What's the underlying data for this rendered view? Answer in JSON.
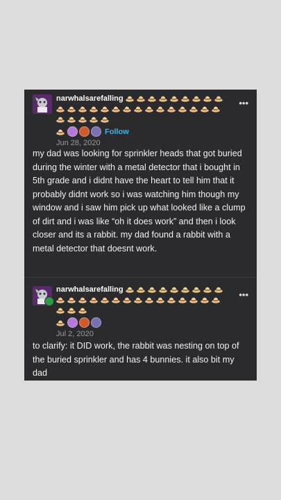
{
  "posts": [
    {
      "username": "narwhalsarefalling",
      "hat_icon": "straw-hat-emoji",
      "hat_count": 29,
      "pics": [
        "#b47ad9",
        "#d05a2a",
        "#7a6fb0"
      ],
      "follow_label": "Follow",
      "date": "Jun 28, 2020",
      "text": "my dad was looking for sprinkler heads that got buried during the winter with a metal detector that i bought in 5th grade and i didnt have the heart to tell him that it probably didnt work so i was watching him though my window and i saw him pick up what looked like a clump of dirt and i was like “oh it does work” and then i look closer and its a rabbit. my dad found a rabbit with a metal detector that doesnt work."
    },
    {
      "username": "narwhalsarefalling",
      "hat_icon": "straw-hat-emoji",
      "hat_count": 27,
      "pics": [
        "#b47ad9",
        "#d05a2a",
        "#7a6fb0"
      ],
      "date": "Jul 2, 2020",
      "text": "to clarify: it DID work, the rabbit was nesting on top of the buried sprinkler and has 4 bunnies. it also bit my dad"
    }
  ],
  "more_label": "•••",
  "colors": {
    "background": "#dcdcdc",
    "card": "#2b2b2d",
    "accent": "#3fb1e8"
  }
}
